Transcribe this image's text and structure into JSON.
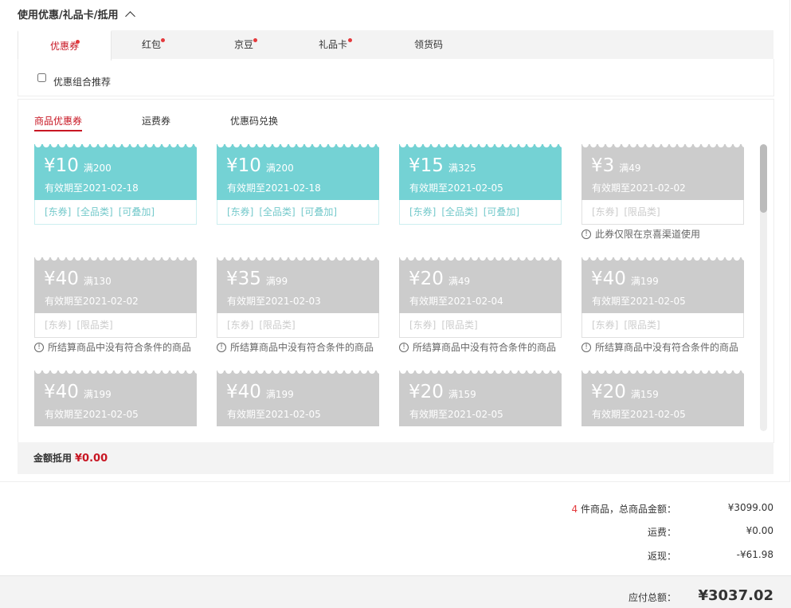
{
  "section_title": "使用优惠/礼品卡/抵用",
  "tabs": [
    {
      "label": "优惠券",
      "dot": true
    },
    {
      "label": "红包",
      "dot": true
    },
    {
      "label": "京豆",
      "dot": true
    },
    {
      "label": "礼品卡",
      "dot": true
    },
    {
      "label": "领货码",
      "dot": false
    }
  ],
  "combo_label": "优惠组合推荐",
  "subtabs": [
    "商品优惠券",
    "运费券",
    "优惠码兑换"
  ],
  "coupons": [
    {
      "amount": "¥10",
      "condition": "满200",
      "expiry": "有效期至2021-02-18",
      "tags": [
        "[东券]",
        "[全品类]",
        "[可叠加]"
      ],
      "available": true,
      "tip": ""
    },
    {
      "amount": "¥10",
      "condition": "满200",
      "expiry": "有效期至2021-02-18",
      "tags": [
        "[东券]",
        "[全品类]",
        "[可叠加]"
      ],
      "available": true,
      "tip": ""
    },
    {
      "amount": "¥15",
      "condition": "满325",
      "expiry": "有效期至2021-02-05",
      "tags": [
        "[东券]",
        "[全品类]",
        "[可叠加]"
      ],
      "available": true,
      "tip": ""
    },
    {
      "amount": "¥3",
      "condition": "满49",
      "expiry": "有效期至2021-02-02",
      "tags": [
        "[东券]",
        "[限品类]"
      ],
      "available": false,
      "tip": "此券仅限在京喜渠道使用"
    },
    {
      "amount": "¥40",
      "condition": "满130",
      "expiry": "有效期至2021-02-02",
      "tags": [
        "[东券]",
        "[限品类]"
      ],
      "available": false,
      "tip": "所结算商品中没有符合条件的商品"
    },
    {
      "amount": "¥35",
      "condition": "满99",
      "expiry": "有效期至2021-02-03",
      "tags": [
        "[东券]",
        "[限品类]"
      ],
      "available": false,
      "tip": "所结算商品中没有符合条件的商品"
    },
    {
      "amount": "¥20",
      "condition": "满49",
      "expiry": "有效期至2021-02-04",
      "tags": [
        "[东券]",
        "[限品类]"
      ],
      "available": false,
      "tip": "所结算商品中没有符合条件的商品"
    },
    {
      "amount": "¥40",
      "condition": "满199",
      "expiry": "有效期至2021-02-05",
      "tags": [
        "[东券]",
        "[限品类]"
      ],
      "available": false,
      "tip": "所结算商品中没有符合条件的商品"
    },
    {
      "amount": "¥40",
      "condition": "满199",
      "expiry": "有效期至2021-02-05",
      "tags": [],
      "available": false,
      "tip": ""
    },
    {
      "amount": "¥40",
      "condition": "满199",
      "expiry": "有效期至2021-02-05",
      "tags": [],
      "available": false,
      "tip": ""
    },
    {
      "amount": "¥20",
      "condition": "满159",
      "expiry": "有效期至2021-02-05",
      "tags": [],
      "available": false,
      "tip": ""
    },
    {
      "amount": "¥20",
      "condition": "满159",
      "expiry": "有效期至2021-02-05",
      "tags": [],
      "available": false,
      "tip": ""
    }
  ],
  "deduct": {
    "label": "金额抵用",
    "value": "¥0.00"
  },
  "summary": {
    "count": "4",
    "count_label": "件商品，总商品金额：",
    "goods_amount": "¥3099.00",
    "shipping_label": "运费：",
    "shipping_amount": "¥0.00",
    "rebate_label": "返现：",
    "rebate_amount": "-¥61.98",
    "total_label": "应付总额：",
    "total_amount": "¥3037.02"
  },
  "colors": {
    "brand_red": "#c81623",
    "coupon_available": "#74d2d4",
    "coupon_disabled": "#cccccc"
  }
}
